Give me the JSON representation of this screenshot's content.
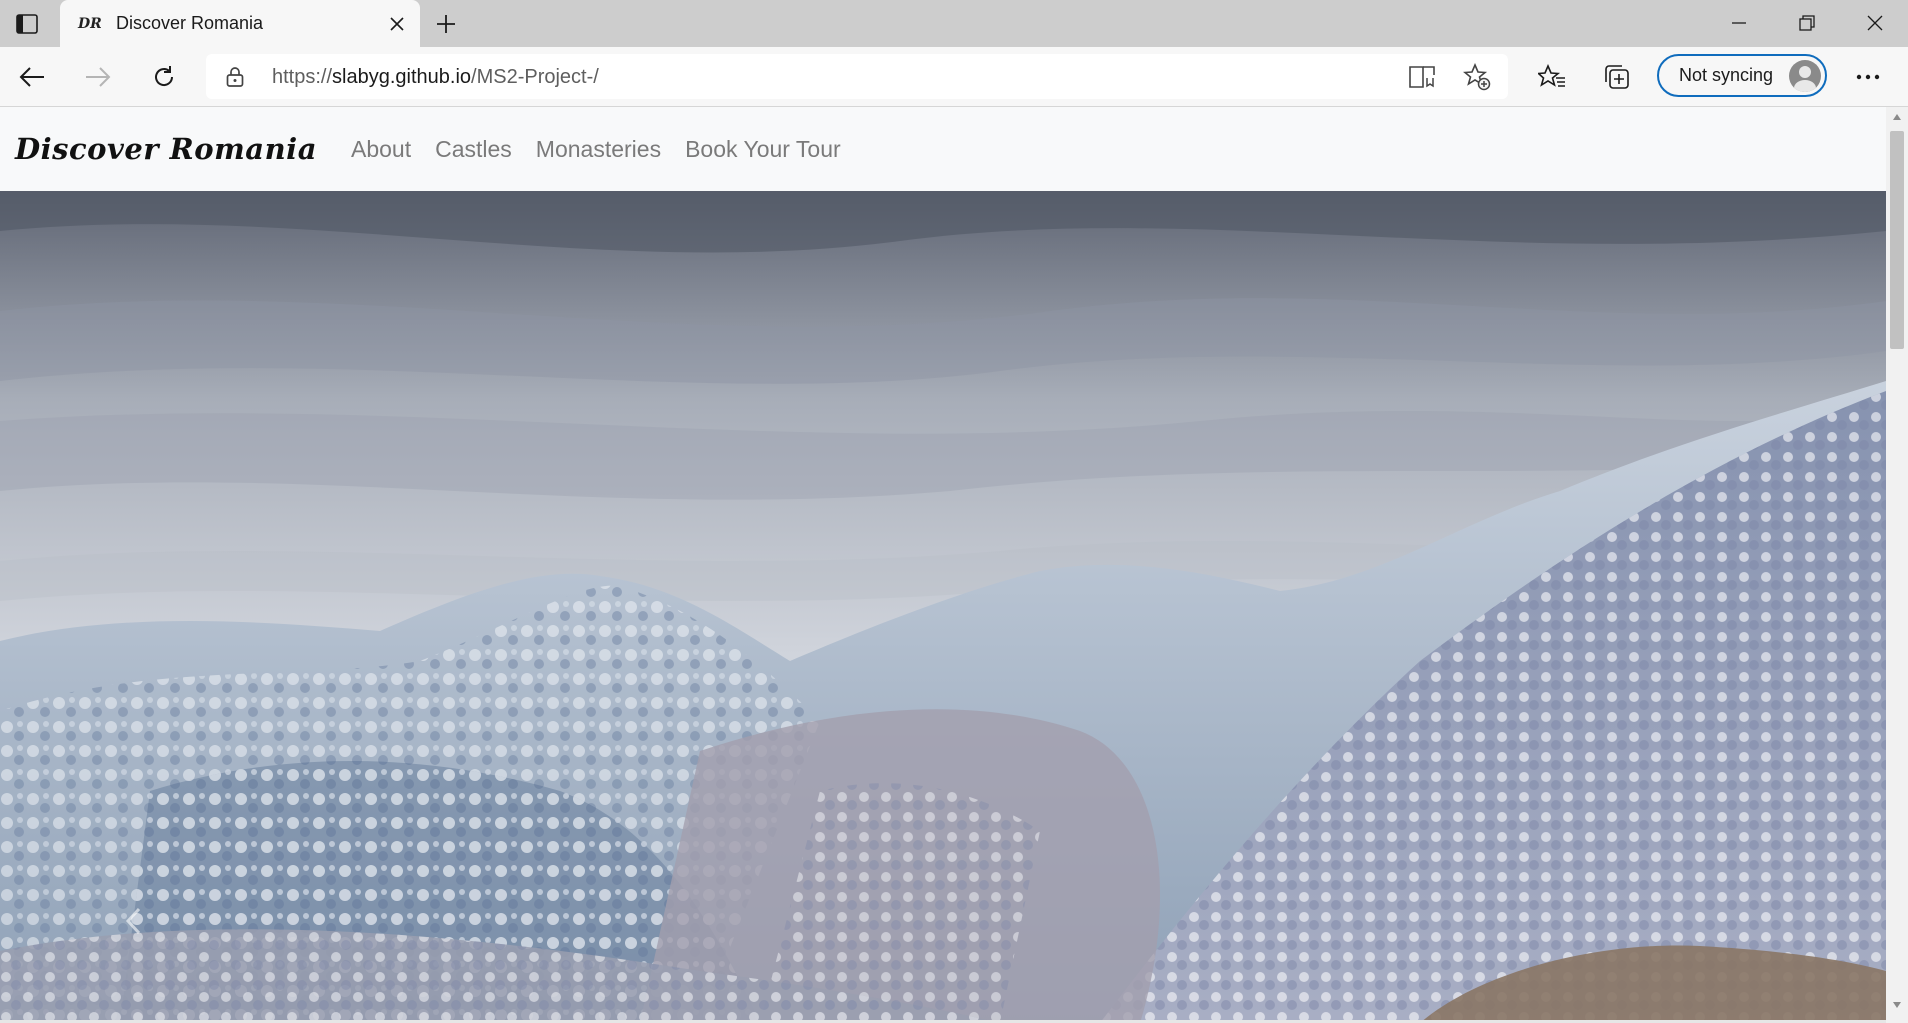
{
  "browser": {
    "tab": {
      "favicon_text": "DR",
      "title": "Discover Romania"
    },
    "address": {
      "scheme": "https://",
      "host": "slabyg.github.io",
      "path": "/MS2-Project-/"
    },
    "sync_label": "Not syncing"
  },
  "site": {
    "brand": "Discover Romania",
    "nav": [
      "About",
      "Castles",
      "Monasteries",
      "Book Your Tour"
    ]
  },
  "icons": {
    "tab_actions": "tab-actions-icon",
    "close": "close-icon",
    "new_tab": "plus-icon",
    "back": "back-arrow-icon",
    "forward": "forward-arrow-icon",
    "refresh": "refresh-icon",
    "lock": "lock-icon",
    "read_aloud": "read-aloud-icon",
    "add_favorite": "add-favorite-icon",
    "favorites": "favorites-icon",
    "collections": "collections-icon",
    "menu": "more-icon"
  }
}
